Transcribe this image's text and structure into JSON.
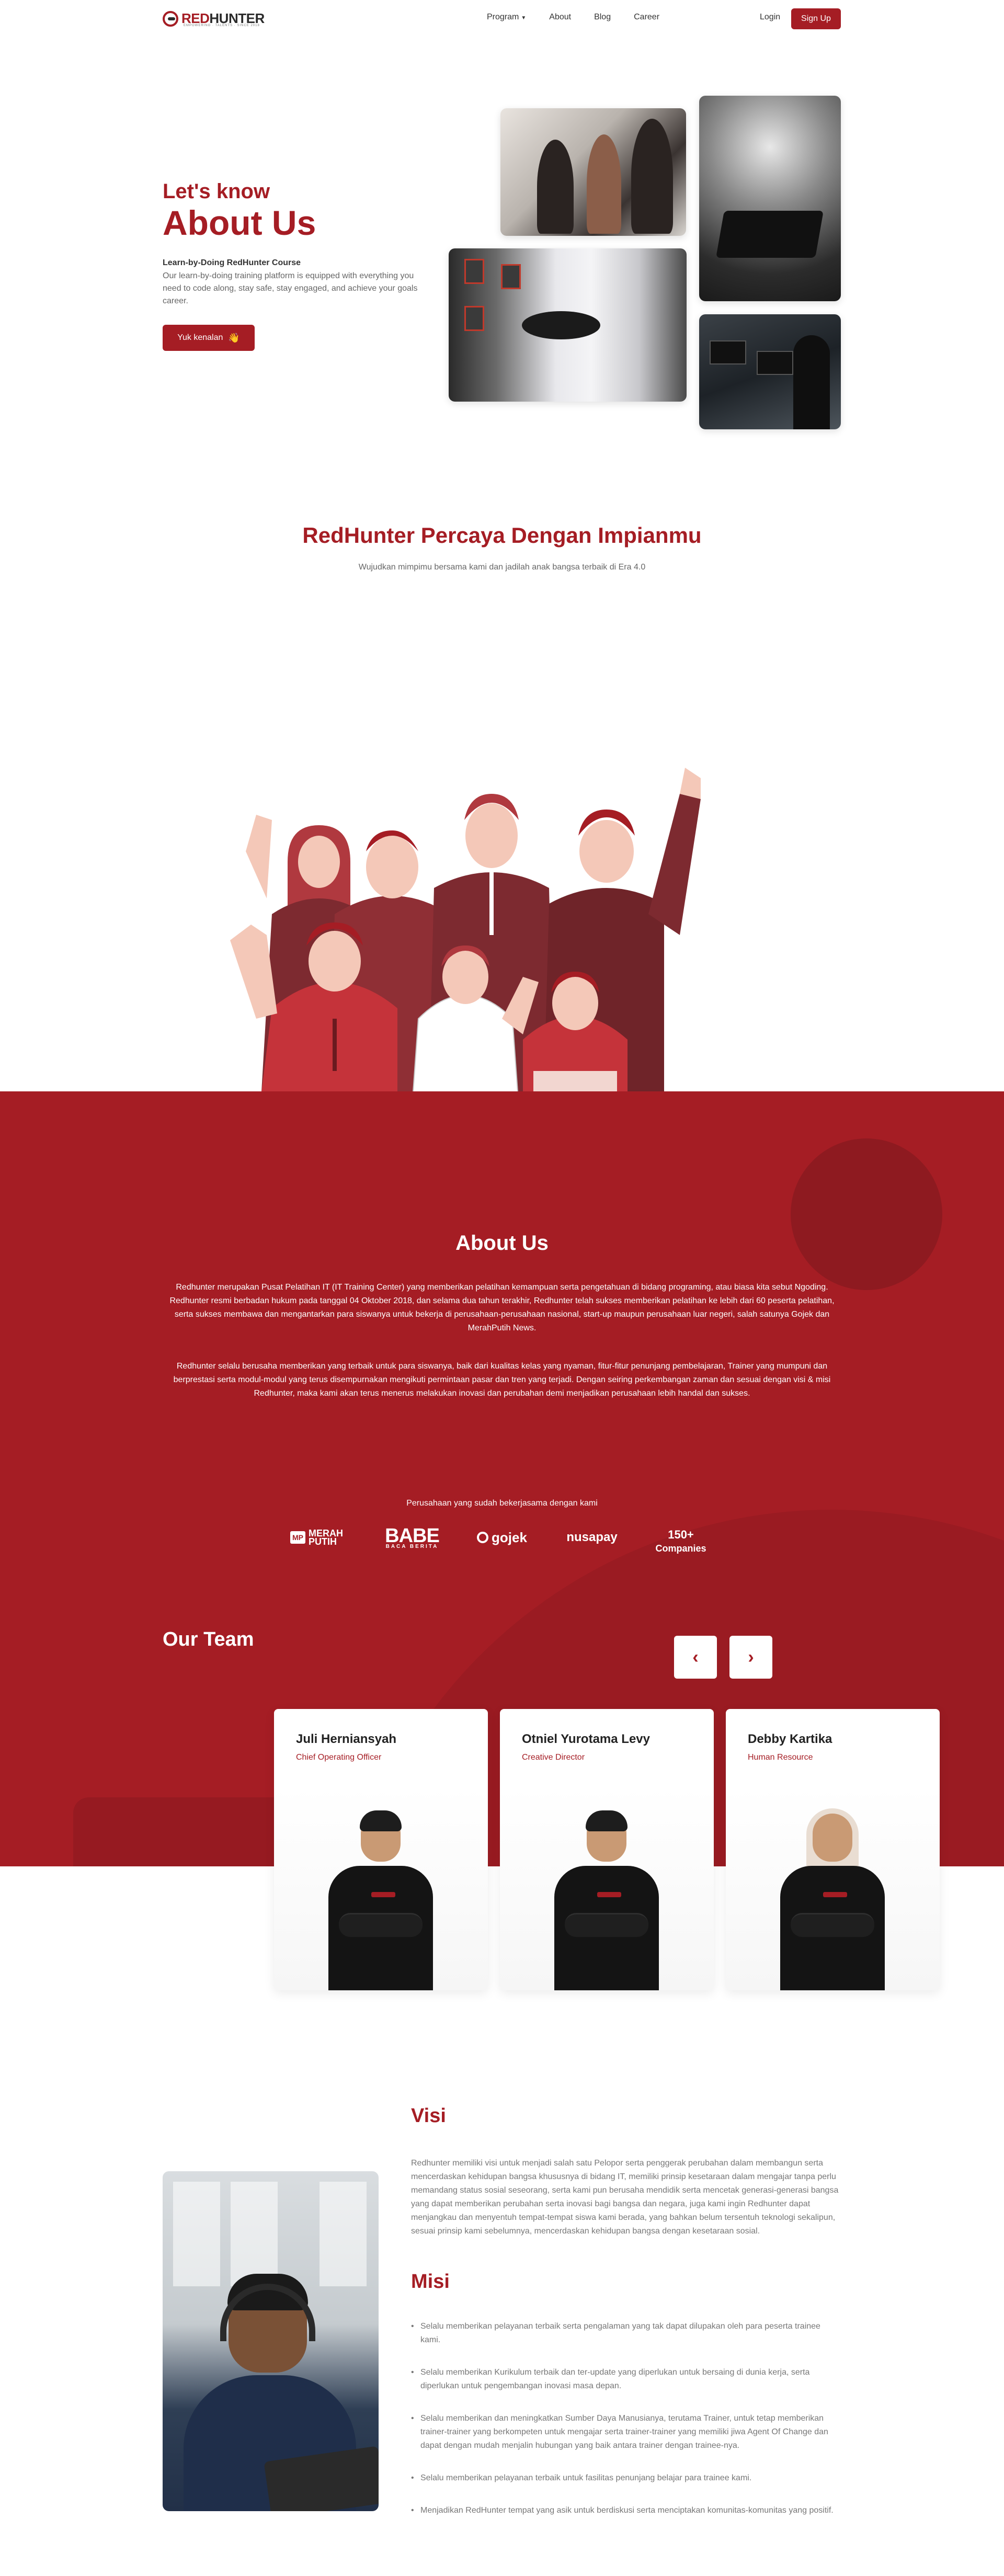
{
  "brand": {
    "name_red": "RED",
    "name_dark": "HUNTER",
    "tagline": "EMPOWERING · TALENTS · SINCE 2018"
  },
  "nav": {
    "items": [
      "Program",
      "About",
      "Blog",
      "Career"
    ],
    "login": "Login",
    "signup": "Sign Up"
  },
  "hero": {
    "kicker": "Let's know",
    "title": "About Us",
    "sub_strong": "Learn-by-Doing RedHunter Course",
    "desc": "Our learn-by-doing training platform is equipped with everything you need to code along, stay safe, stay engaged, and achieve your goals career.",
    "button": "Yuk kenalan",
    "button_emoji": "👋"
  },
  "belief": {
    "title": "RedHunter Percaya Dengan Impianmu",
    "sub": "Wujudkan mimpimu bersama kami dan jadilah anak bangsa terbaik di Era 4.0"
  },
  "about": {
    "title": "About Us",
    "p1": "Redhunter merupakan Pusat Pelatihan IT (IT Training Center) yang memberikan pelatihan kemampuan serta pengetahuan di bidang programing, atau biasa kita sebut Ngoding. Redhunter resmi berbadan hukum pada tanggal 04 Oktober 2018, dan selama dua tahun terakhir, Redhunter telah sukses memberikan pelatihan ke lebih dari 60 peserta pelatihan, serta sukses membawa dan mengantarkan para siswanya untuk bekerja di perusahaan-perusahaan nasional, start-up maupun perusahaan luar negeri, salah satunya Gojek dan MerahPutih News.",
    "p2": "Redhunter selalu berusaha memberikan yang terbaik untuk para siswanya, baik dari kualitas kelas yang nyaman, fitur-fitur penunjang pembelajaran, Trainer yang mumpuni dan berprestasi serta modul-modul yang terus disempurnakan mengikuti permintaan pasar dan tren yang terjadi. Dengan seiring perkembangan zaman dan sesuai dengan visi & misi Redhunter, maka kami akan terus menerus melakukan inovasi dan perubahan demi menjadikan perusahaan lebih handal dan sukses."
  },
  "partners": {
    "caption": "Perusahaan yang sudah bekerjasama dengan kami",
    "merah_box": "MP",
    "merah_text": "MERAH PUTIH",
    "babe": "BABE",
    "babe_sub": "BACA BERITA",
    "gojek": "gojek",
    "nusapay": "nusapay",
    "more_count": "150+",
    "more_label": "Companies"
  },
  "team": {
    "title": "Our Team",
    "prev": "‹",
    "next": "›",
    "members": [
      {
        "name": "Juli Herniansyah",
        "role": "Chief Operating Officer"
      },
      {
        "name": "Otniel Yurotama Levy",
        "role": "Creative Director"
      },
      {
        "name": "Debby Kartika",
        "role": "Human Resource"
      }
    ]
  },
  "visi": {
    "title": "Visi",
    "text": "Redhunter memiliki visi untuk menjadi salah satu Pelopor serta penggerak perubahan dalam membangun serta mencerdaskan kehidupan bangsa khususnya di bidang IT, memiliki prinsip kesetaraan dalam mengajar tanpa perlu memandang status sosial seseorang, serta kami pun berusaha mendidik serta mencetak generasi-generasi bangsa yang dapat memberikan perubahan serta inovasi bagi bangsa dan negara, juga kami ingin Redhunter dapat menjangkau dan menyentuh tempat-tempat siswa kami berada, yang bahkan belum tersentuh teknologi sekalipun, sesuai prinsip kami sebelumnya, mencerdaskan kehidupan bangsa dengan kesetaraan sosial."
  },
  "misi": {
    "title": "Misi",
    "items": [
      "Selalu memberikan pelayanan terbaik serta pengalaman yang tak dapat dilupakan oleh para peserta trainee kami.",
      "Selalu memberikan Kurikulum terbaik dan ter-update yang diperlukan untuk bersaing di dunia kerja, serta diperlukan untuk pengembangan inovasi masa depan.",
      "Selalu memberikan dan meningkatkan Sumber Daya Manusianya, terutama Trainer, untuk tetap memberikan trainer-trainer yang berkompeten untuk mengajar serta trainer-trainer yang memiliki jiwa Agent Of Change dan dapat dengan mudah menjalin hubungan yang baik antara trainer dengan trainee-nya.",
      "Selalu memberikan pelayanan terbaik untuk fasilitas penunjang belajar para trainee kami.",
      "Menjadikan RedHunter tempat yang asik untuk berdiskusi serta menciptakan komunitas-komunitas yang positif."
    ]
  },
  "colors": {
    "brand_red": "#a51d24",
    "dark_red": "#8e1a20",
    "white": "#ffffff"
  },
  "icons": [
    "chevron-down-icon",
    "wave-hand-icon",
    "chevron-left-icon",
    "chevron-right-icon"
  ]
}
